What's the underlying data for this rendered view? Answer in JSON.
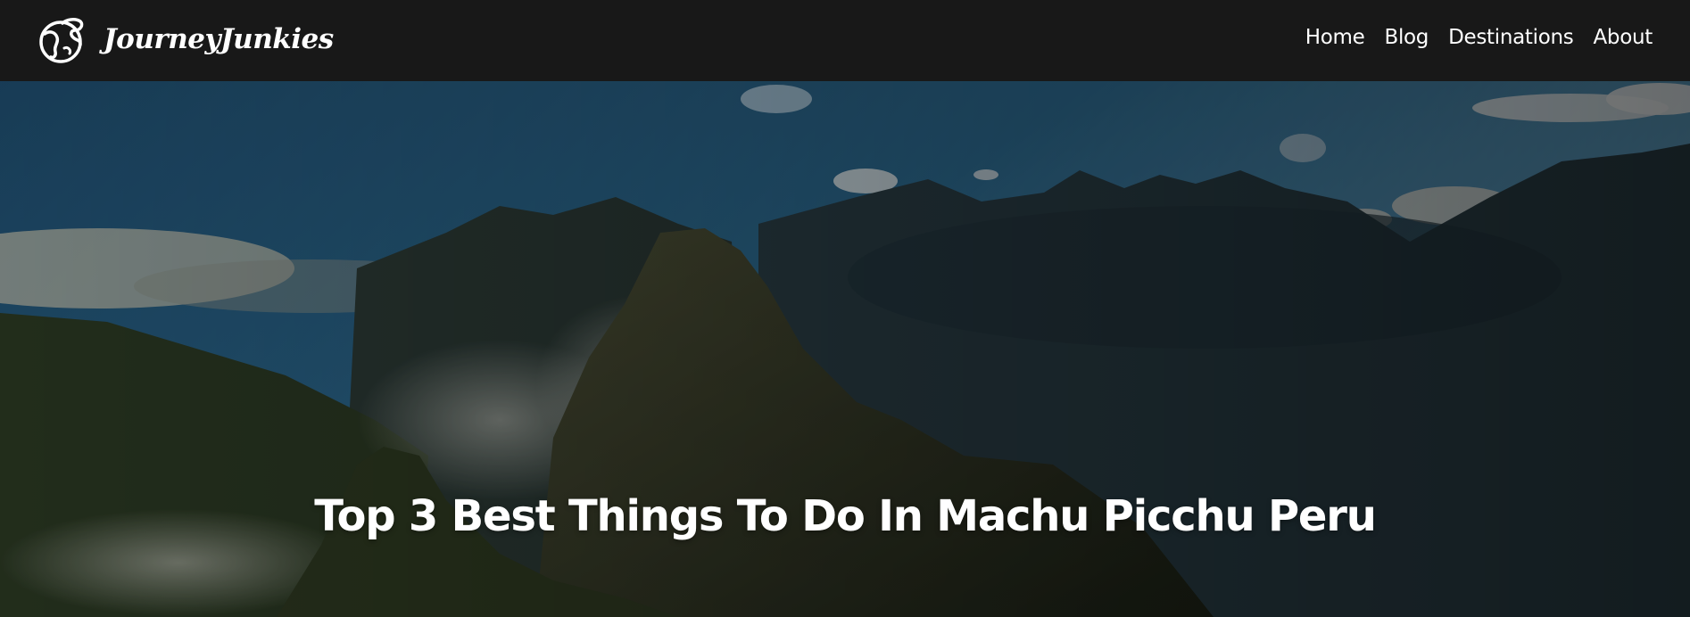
{
  "brand": {
    "name": "JourneyJunkies",
    "logo_icon": "globe-icon"
  },
  "nav": {
    "items": [
      "Home",
      "Blog",
      "Destinations",
      "About"
    ]
  },
  "hero": {
    "title": "Top 3 Best Things To Do In Machu Picchu Peru",
    "image_subject": "mountain-landscape-image"
  },
  "colors": {
    "navbar_bg": "#181818",
    "text": "#ffffff",
    "sky": "#3f86ad"
  }
}
